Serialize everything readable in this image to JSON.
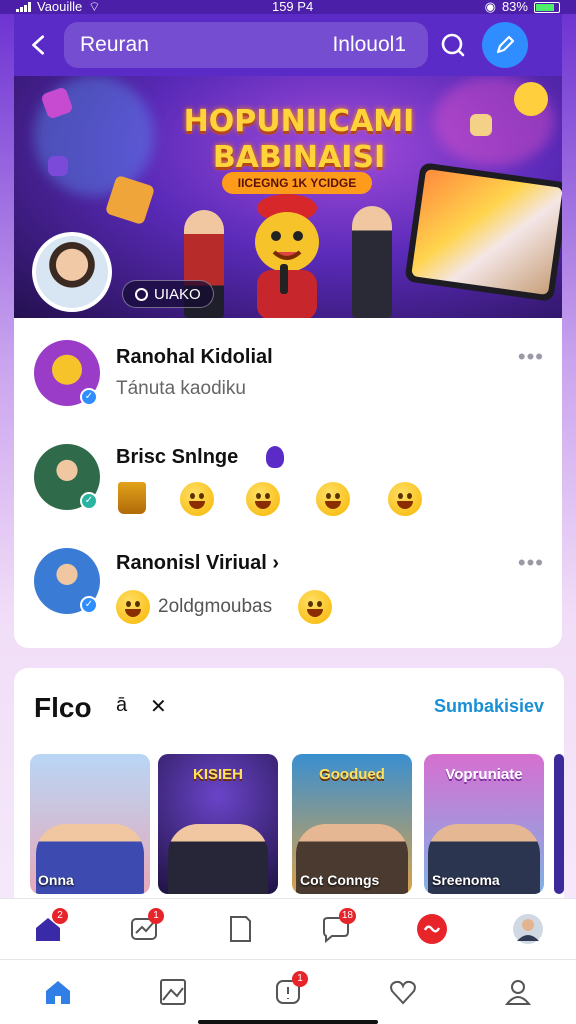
{
  "status_bar": {
    "carrier": "Vaouille",
    "time": "159 P4",
    "battery": "83%"
  },
  "top_bar": {
    "search_placeholder": "Reuran",
    "search_tag": "Inlouol1"
  },
  "banner": {
    "title_line1": "HOPUNIICAMI",
    "title_line2": "BABINAISI",
    "subtitle": "IICEGNG 1K YCIDGE",
    "live_badge": "UIAKO"
  },
  "feed": [
    {
      "name": "Ranohal Kidolial",
      "subtitle": "Tánuta kaodiku",
      "more": "•••",
      "avatar_color": "#9b3cc8"
    },
    {
      "name": "Brisc Snlnge",
      "subtitle": "",
      "more": "",
      "avatar_color": "#2f6b4a"
    },
    {
      "name": "Ranonisl Viriual ›",
      "subtitle": "2oldgmoubas",
      "more": "•••",
      "avatar_color": "#3a7bd5"
    }
  ],
  "friends": {
    "title": "Flco",
    "link": "Sumbakisiev",
    "items": [
      {
        "caption": "Onna",
        "title": ""
      },
      {
        "caption": "",
        "title": "KISIEH"
      },
      {
        "caption": "Cot Conngs",
        "title": "Goodued"
      },
      {
        "caption": "Sreenoma",
        "title": "Vopruniate"
      }
    ]
  },
  "tabbar_top": [
    {
      "icon": "home-icon",
      "badge": "2"
    },
    {
      "icon": "trending-icon",
      "badge": "1"
    },
    {
      "icon": "page-icon",
      "badge": ""
    },
    {
      "icon": "chat-icon",
      "badge": "18"
    },
    {
      "icon": "live-icon",
      "badge": ""
    },
    {
      "icon": "profile-photo-icon",
      "badge": ""
    }
  ],
  "tabbar_bottom": [
    {
      "icon": "home-icon",
      "badge": ""
    },
    {
      "icon": "gallery-icon",
      "badge": ""
    },
    {
      "icon": "notification-icon",
      "badge": "1"
    },
    {
      "icon": "heart-icon",
      "badge": ""
    },
    {
      "icon": "user-icon",
      "badge": ""
    }
  ],
  "colors": {
    "accent": "#5b2bc8",
    "link": "#1a8fd6",
    "badge": "#e8242b",
    "compose": "#2f8dff"
  }
}
